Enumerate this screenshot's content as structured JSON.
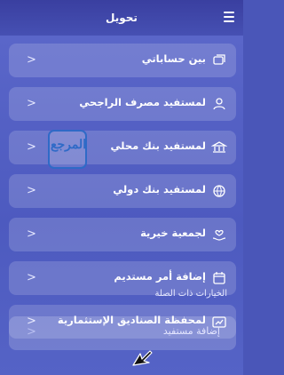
{
  "header": {
    "title": "تحويل",
    "menu_icon": "hamburger-menu-icon"
  },
  "rows": [
    {
      "label": "بين حساباتي",
      "icon": "accounts-transfer-icon"
    },
    {
      "label": "لمستفيد مصرف الراجحي",
      "icon": "bank-beneficiary-icon"
    },
    {
      "label": "لمستفيد بنك محلي",
      "icon": "local-bank-icon"
    },
    {
      "label": "لمستفيد بنك دولي",
      "icon": "international-bank-icon"
    },
    {
      "label": "لجمعية خيرية",
      "icon": "charity-hands-icon"
    },
    {
      "label": "إضافة أمر مستديم",
      "icon": "standing-order-icon"
    },
    {
      "label": "لمحفظة الصناديق الإستثمارية",
      "icon": "investment-portfolio-icon"
    }
  ],
  "chevron": "<",
  "related": {
    "section_label": "الخيارات ذات الصلة",
    "items": [
      {
        "label": "إضافة مستفيد"
      }
    ]
  },
  "watermark_text": "المرجع",
  "colors": {
    "background": "#4a56b8",
    "card": "rgba(255,255,255,0.16)",
    "accent": "#2f6ac7"
  }
}
